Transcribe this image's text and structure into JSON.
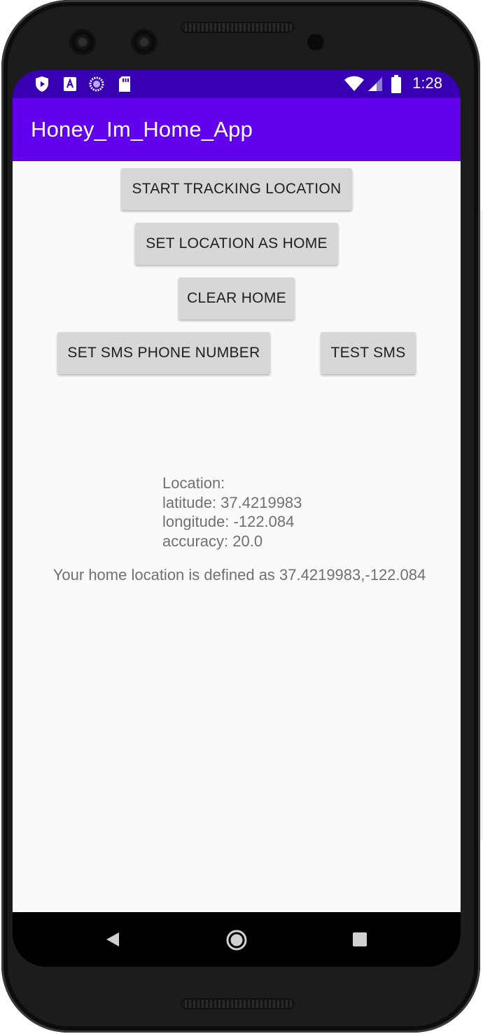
{
  "status_bar": {
    "time": "1:28",
    "left_icons": [
      "shield-play-icon",
      "font-a-icon",
      "circle-progress-icon",
      "sd-card-icon"
    ],
    "right_icons": [
      "wifi-icon",
      "cell-signal-icon",
      "battery-icon"
    ],
    "color": "#3700b3"
  },
  "app_bar": {
    "title": "Honey_Im_Home_App",
    "color": "#6200ee"
  },
  "buttons": {
    "start_tracking": "START TRACKING LOCATION",
    "set_home": "SET LOCATION AS HOME",
    "clear_home": "CLEAR HOME",
    "set_sms_number": "SET SMS PHONE NUMBER",
    "test_sms": "TEST SMS"
  },
  "location": {
    "heading": "Location:",
    "latitude": "latitude: 37.4219983",
    "longitude": "longitude: -122.084",
    "accuracy": "accuracy: 20.0"
  },
  "home_location_text": "Your home location is defined as 37.4219983,-122.084",
  "nav_bar": {
    "icons": [
      "back-icon",
      "home-icon",
      "recents-icon"
    ]
  }
}
